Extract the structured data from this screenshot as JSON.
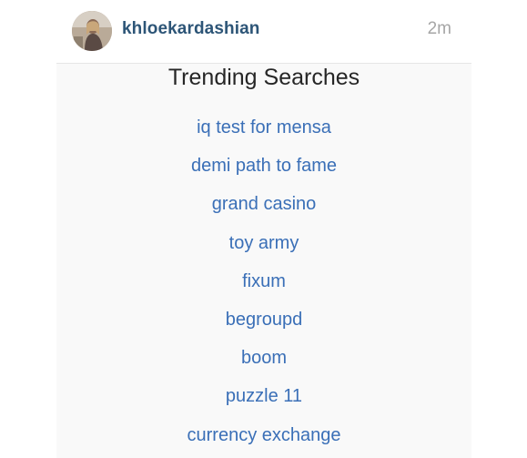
{
  "post": {
    "username": "khloekardashian",
    "timestamp": "2m"
  },
  "trending": {
    "title": "Trending Searches",
    "items": [
      "iq test for mensa",
      "demi path to fame",
      "grand casino",
      "toy army",
      "fixum",
      "begroupd",
      "boom",
      "puzzle 11",
      "currency exchange"
    ]
  },
  "colors": {
    "username": "#2d5577",
    "link": "#3a6fb7",
    "timestamp": "#a6a6a6",
    "background": "#f9f9f9"
  }
}
